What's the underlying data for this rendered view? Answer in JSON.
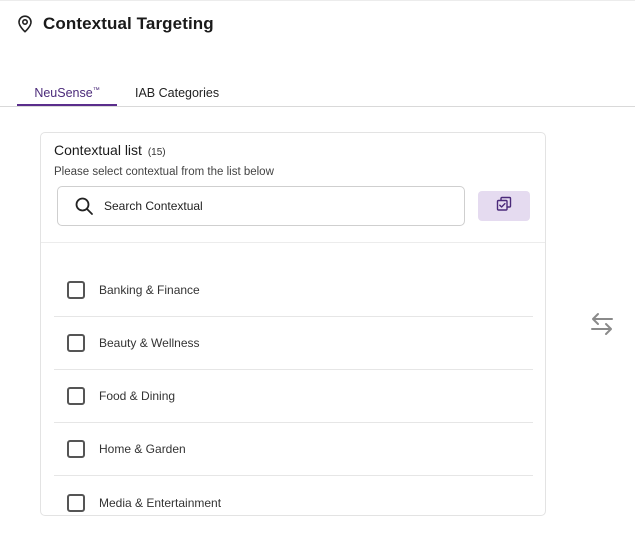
{
  "header": {
    "title": "Contextual Targeting",
    "icon": "location-pin-icon"
  },
  "tabs": [
    {
      "label": "NeuSense",
      "superscript": "™",
      "active": true
    },
    {
      "label": "IAB Categories",
      "active": false
    }
  ],
  "contextual": {
    "title": "Contextual list",
    "count": "(15)",
    "subtitle": "Please select contextual from the list below",
    "search_placeholder": "Search Contextual",
    "items": [
      {
        "label": "Banking & Finance",
        "checked": false
      },
      {
        "label": "Beauty & Wellness",
        "checked": false
      },
      {
        "label": "Food & Dining",
        "checked": false
      },
      {
        "label": "Home & Garden",
        "checked": false
      },
      {
        "label": "Media & Entertainment",
        "checked": false
      }
    ]
  },
  "colors": {
    "accent": "#5a2d8c",
    "accent_light": "#e5dbf0",
    "icon_gray": "#8a8a8a"
  }
}
